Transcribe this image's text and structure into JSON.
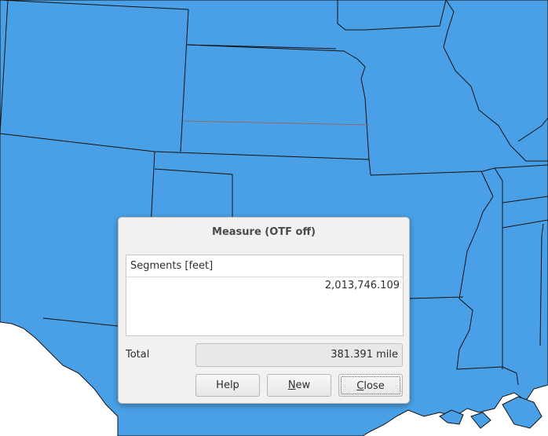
{
  "dialog": {
    "title": "Measure (OTF off)",
    "segments_header": "Segments [feet]",
    "segments": [
      "2,013,746.109"
    ],
    "total_label": "Total",
    "total_value": "381.391 mile",
    "buttons": {
      "help": "Help",
      "new_mnemonic": "N",
      "new_rest": "ew",
      "close_mnemonic": "C",
      "close_rest": "lose"
    }
  },
  "colors": {
    "map_fill": "#4aa0e6",
    "boundary": "#111111",
    "measure_line": "#8a6a6a"
  }
}
